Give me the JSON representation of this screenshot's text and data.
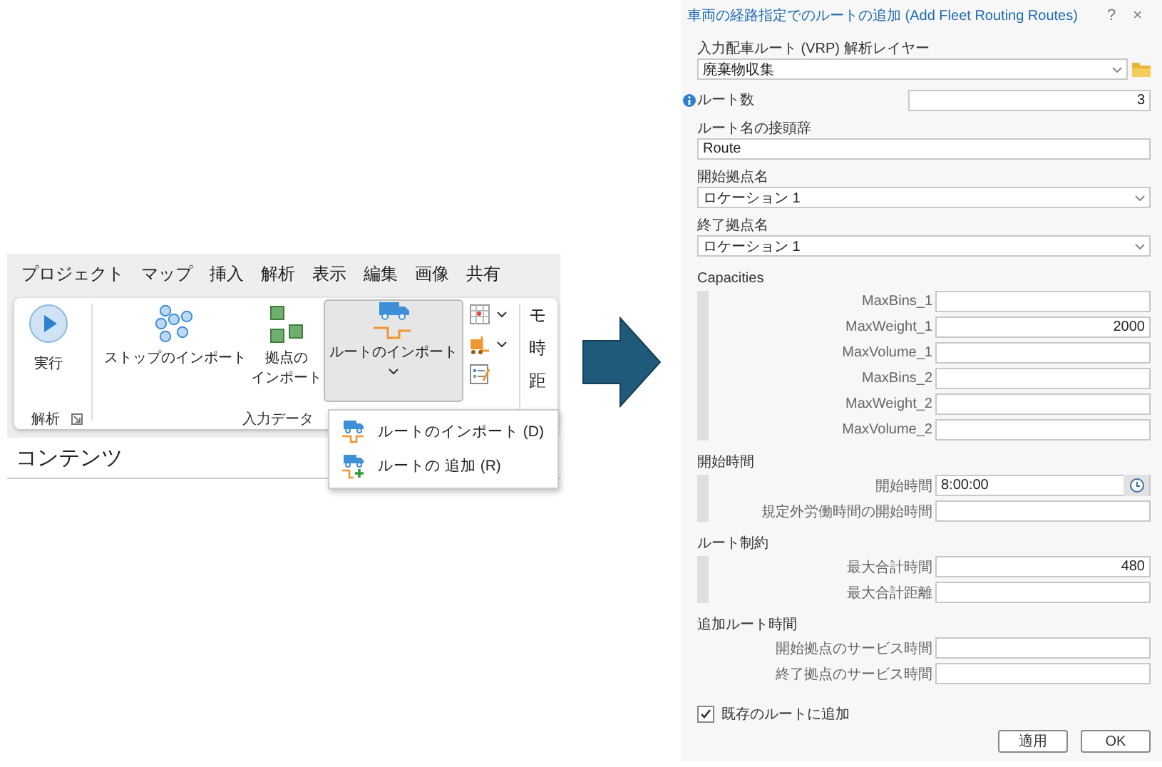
{
  "ribbon": {
    "menu_tabs": [
      "プロジェクト",
      "マップ",
      "挿入",
      "解析",
      "表示",
      "編集",
      "画像",
      "共有"
    ],
    "run_button": {
      "label": "実行"
    },
    "import_stops": {
      "label_lines": [
        "ストップのインポート"
      ]
    },
    "import_depots": {
      "label_lines": [
        "拠点の",
        "インポート"
      ]
    },
    "import_routes": {
      "label": "ルートのインポート",
      "expanded": true
    },
    "cut_labels": [
      "モ",
      "時",
      "距"
    ],
    "groups": [
      "解析",
      "入力データ"
    ],
    "dropdown_menu": [
      {
        "label": "ルートのインポート (D)",
        "kind": "import"
      },
      {
        "label": "ルートの 追加 (R)",
        "kind": "add"
      }
    ],
    "contents_pane": {
      "title": "コンテンツ"
    }
  },
  "dialog": {
    "title": "車両の経路指定でのルートの追加 (Add Fleet Routing Routes)",
    "help": "?",
    "close": "×",
    "fields": [
      {
        "kind": "dropdown",
        "label": "入力配車ルート (VRP) 解析レイヤー",
        "value": "廃棄物収集",
        "browse": true
      },
      {
        "kind": "number",
        "label": "ルート数",
        "value": "3"
      },
      {
        "kind": "text",
        "label": "ルート名の接頭辞",
        "value": "Route"
      },
      {
        "kind": "dropdown",
        "label": "開始拠点名",
        "value": "ロケーション 1",
        "browse": false
      },
      {
        "kind": "dropdown",
        "label": "終了拠点名",
        "value": "ロケーション 1",
        "browse": false
      }
    ],
    "sections": [
      {
        "title": "Capacities",
        "bar": true,
        "rows": [
          {
            "label": "MaxBins_1",
            "kind": "text"
          },
          {
            "label": "MaxWeight_1",
            "value": "2000",
            "kind": "text"
          },
          {
            "label": "MaxVolume_1",
            "kind": "text"
          },
          {
            "label": "MaxBins_2",
            "kind": "text"
          },
          {
            "label": "MaxWeight_2",
            "kind": "text"
          },
          {
            "label": "MaxVolume_2",
            "kind": "text"
          }
        ]
      },
      {
        "title": "開始時間",
        "bar": true,
        "rows": [
          {
            "label": "開始時間",
            "value": "8:00:00",
            "kind": "time"
          },
          {
            "label": "規定外労働時間の開始時間",
            "kind": "text"
          }
        ]
      },
      {
        "title": "ルート制約",
        "bar": true,
        "rows": [
          {
            "label": "最大合計時間",
            "value": "480",
            "kind": "text"
          },
          {
            "label": "最大合計距離",
            "kind": "text"
          }
        ]
      },
      {
        "title": "追加ルート時間",
        "bar": false,
        "rows": [
          {
            "label": "開始拠点のサービス時間",
            "kind": "text"
          },
          {
            "label": "終了拠点のサービス時間",
            "kind": "text"
          }
        ]
      }
    ],
    "append_checkbox": {
      "label": "既存のルートに追加",
      "checked": true
    },
    "buttons": [
      "適用",
      "OK"
    ]
  }
}
